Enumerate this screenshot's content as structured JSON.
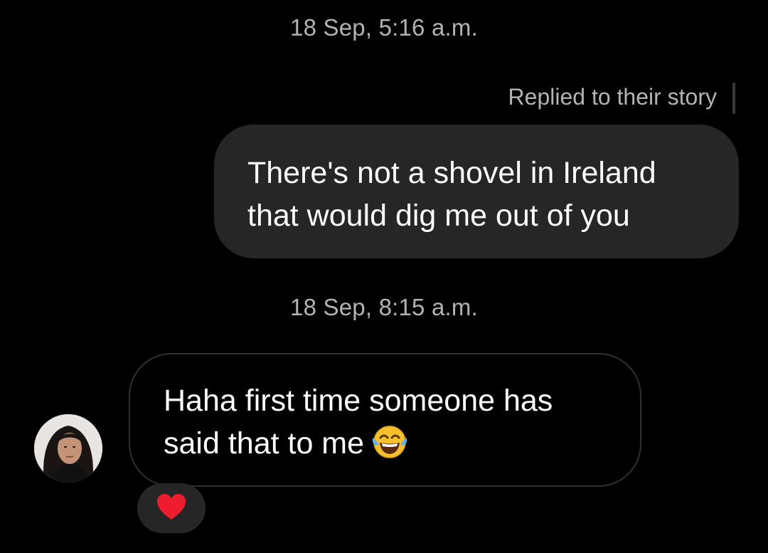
{
  "thread": {
    "timestamp_1": "18 Sep, 5:16 a.m.",
    "reply_note": "Replied to their story",
    "sent_message": {
      "line_1": "There's not a shovel in Ireland",
      "line_2": "that would dig me out of you"
    },
    "timestamp_2": "18 Sep, 8:15 a.m.",
    "received_message": {
      "line_1": "Haha first time someone has",
      "line_2": "said that to me",
      "emoji": "face-with-tears-of-joy"
    },
    "reaction": "heart"
  },
  "colors": {
    "background": "#000000",
    "sent_bubble": "#262626",
    "received_border": "#303030",
    "meta_text": "#b3b3b3",
    "heart": "#ed1c2e"
  }
}
